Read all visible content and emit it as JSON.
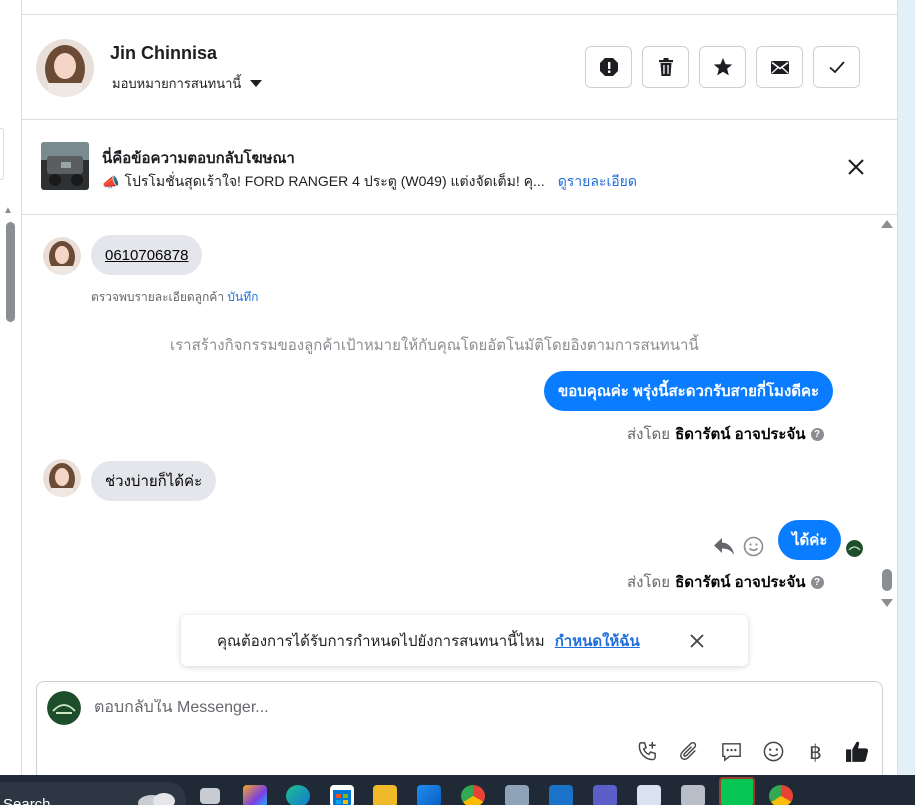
{
  "header": {
    "name": "Jin Chinnisa",
    "assign_label": "มอบหมายการสนทนานี้",
    "actions": [
      "spam-icon",
      "trash-icon",
      "star-icon",
      "mail-icon",
      "check-icon"
    ]
  },
  "ad_banner": {
    "title": "นี่คือข้อความตอบกลับโฆษณา",
    "description": "โปรโมชั่นสุดเร้าใจ! FORD RANGER 4 ประตู (W049) แต่งจัดเต็ม! คุ...",
    "link": "ดูรายละเอียด",
    "emoji": "📣"
  },
  "messages": {
    "phone": "0610706878",
    "detect_label": "ตรวจพบรายละเอียดลูกค้า",
    "detect_action": "บันทึก",
    "system_note": "เราสร้างกิจกรรมของลูกค้าเป้าหมายให้กับคุณโดยอัตโนมัติโดยอิงตามการสนทนานี้",
    "out_1": "ขอบคุณค่ะ พรุ่งนี้สะดวกรับสายกี่โมงดีคะ",
    "in_2": "ช่วงบ่ายก็ได้ค่ะ",
    "out_2": "ได้ค่ะ",
    "sent_by_prefix": "ส่งโดย",
    "sent_by_name": "ธิดารัตน์ อาจประจัน",
    "info_mark": "?"
  },
  "toast": {
    "text": "คุณต้องการได้รับการกำหนดไปยังการสนทนานี้ไหม",
    "link": "กำหนดให้ฉัน"
  },
  "composer": {
    "placeholder": "ตอบกลับใน Messenger...",
    "tools": [
      "call-add-icon",
      "attach-icon",
      "saved-reply-icon",
      "emoji-icon",
      "baht-icon",
      "like-icon"
    ],
    "baht": "฿"
  },
  "taskbar": {
    "search_label": "Search"
  },
  "colors": {
    "accent_blue": "#0a7cff",
    "link_blue": "#216fdb",
    "incoming_bubble": "#e4e6eb",
    "taskbar": "#1f2a36"
  }
}
